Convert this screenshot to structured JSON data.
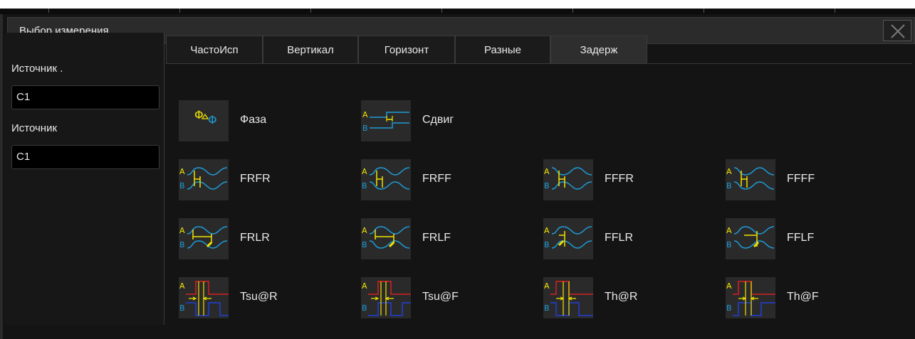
{
  "dialog": {
    "title": "Выбор измерения"
  },
  "sources": {
    "source1_label": "Источник .",
    "source1_value": "C1",
    "source2_label": "Источник",
    "source2_value": "C1"
  },
  "tabs": [
    {
      "label": "ЧастоИсп",
      "active": false
    },
    {
      "label": "Вертикал",
      "active": false
    },
    {
      "label": "Горизонт",
      "active": false
    },
    {
      "label": "Разные",
      "active": false
    },
    {
      "label": "Задерж",
      "active": true
    }
  ],
  "measurements": [
    {
      "label": "Фаза",
      "icon": "phase-icon"
    },
    {
      "label": "Сдвиг",
      "icon": "skew-icon"
    },
    {
      "label": "FRFR",
      "icon": "frfr-icon"
    },
    {
      "label": "FRFF",
      "icon": "frff-icon"
    },
    {
      "label": "FFFR",
      "icon": "fffr-icon"
    },
    {
      "label": "FFFF",
      "icon": "ffff-icon"
    },
    {
      "label": "FRLR",
      "icon": "frlr-icon"
    },
    {
      "label": "FRLF",
      "icon": "frlf-icon"
    },
    {
      "label": "FFLR",
      "icon": "fflr-icon"
    },
    {
      "label": "FFLF",
      "icon": "fflf-icon"
    },
    {
      "label": "Tsu@R",
      "icon": "tsu-r-icon"
    },
    {
      "label": "Tsu@F",
      "icon": "tsu-f-icon"
    },
    {
      "label": "Th@R",
      "icon": "th-r-icon"
    },
    {
      "label": "Th@F",
      "icon": "th-f-icon"
    }
  ],
  "colors": {
    "channel_a": "#f2e300",
    "channel_b": "#1e9bd7",
    "signal_red": "#d81f1f",
    "signal_blue": "#1f3fd8",
    "panel_bg": "#141414"
  }
}
